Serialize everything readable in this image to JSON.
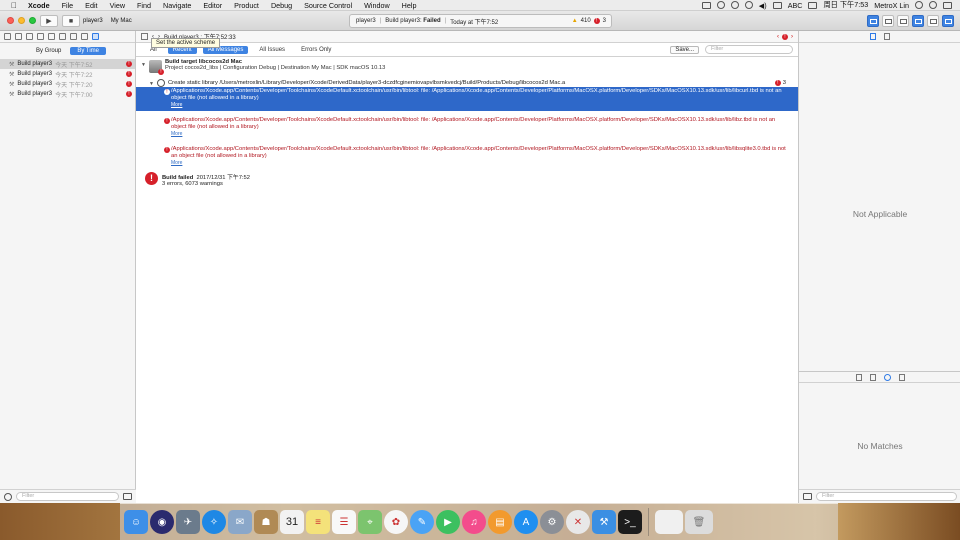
{
  "menubar": {
    "apple": "",
    "items": [
      "Xcode",
      "File",
      "Edit",
      "View",
      "Find",
      "Navigate",
      "Editor",
      "Product",
      "Debug",
      "Source Control",
      "Window",
      "Help"
    ],
    "input_source": "ABC",
    "clock": "周日 下午7:53",
    "user": "MetroX Lin"
  },
  "toolbar": {
    "run_glyph": "▶",
    "stop_glyph": "■",
    "scheme": "player3",
    "destination": "My Mac",
    "activity": {
      "project": "player3",
      "status_prefix": "Build player3:",
      "status_result": "Failed",
      "time": "Today at 下午7:52",
      "warnings": "410",
      "errors": "3"
    }
  },
  "tooltip": "Set the active scheme",
  "navigator": {
    "segments": [
      "By Group",
      "By Time"
    ],
    "items": [
      {
        "label": "Build player3",
        "time": "今天 下午7:52",
        "badge": "!"
      },
      {
        "label": "Build player3",
        "time": "今天 下午7:22",
        "badge": "!"
      },
      {
        "label": "Build player3",
        "time": "今天 下午7:20",
        "badge": "!"
      },
      {
        "label": "Build player3",
        "time": "今天 下午7:00",
        "badge": "!"
      }
    ],
    "filter_placeholder": "Filter"
  },
  "jumpbar": {
    "crumb": "Build player3 : 下午7:52:33"
  },
  "filterbar": {
    "scope": [
      "All",
      "Recent"
    ],
    "types": [
      "All Messages",
      "All Issues",
      "Errors Only"
    ],
    "save": "Save...",
    "filter_placeholder": "Filter"
  },
  "log": {
    "target_title": "Build target libcocos2d Mac",
    "target_detail": "Project cocos2d_libs | Configuration Debug | Destination My Mac | SDK macOS 10.13",
    "task": "Create static library /Users/metroxlin/Library/Developer/Xcode/DerivedData/player3-dczdfcginemiovapvlbsmkvedcj/Build/Products/Debug/libcocos2d Mac.a",
    "task_errors": "3",
    "messages": [
      {
        "text": "/Applications/Xcode.app/Contents/Developer/Toolchains/XcodeDefault.xctoolchain/usr/bin/libtool: file: /Applications/Xcode.app/Contents/Developer/Platforms/MacOSX.platform/Developer/SDKs/MacOSX10.13.sdk/usr/lib/libcurl.tbd is not an object file (not allowed in a library)",
        "more": "More"
      },
      {
        "text": "/Applications/Xcode.app/Contents/Developer/Toolchains/XcodeDefault.xctoolchain/usr/bin/libtool: file: /Applications/Xcode.app/Contents/Developer/Platforms/MacOSX.platform/Developer/SDKs/MacOSX10.13.sdk/usr/lib/libz.tbd is not an object file (not allowed in a library)",
        "more": "More"
      },
      {
        "text": "/Applications/Xcode.app/Contents/Developer/Toolchains/XcodeDefault.xctoolchain/usr/bin/libtool: file: /Applications/Xcode.app/Contents/Developer/Platforms/MacOSX.platform/Developer/SDKs/MacOSX10.13.sdk/usr/lib/libsqlite3.0.tbd is not an object file (not allowed in a library)",
        "more": "More"
      }
    ],
    "build_failed": "Build failed",
    "build_failed_time": "2017/12/31 下午7:52",
    "summary": "3 errors, 6073 warnings"
  },
  "inspector": {
    "not_applicable": "Not Applicable",
    "no_matches": "No Matches",
    "filter_placeholder": "Filter"
  },
  "dock": {
    "items": [
      {
        "name": "finder-icon",
        "color": "#3d8fe8",
        "glyph": "☺"
      },
      {
        "name": "siri-icon",
        "color": "#2a2a6e",
        "glyph": "◉"
      },
      {
        "name": "launchpad-icon",
        "color": "#6b7b8c",
        "glyph": "✈"
      },
      {
        "name": "safari-icon",
        "color": "#1e88e5",
        "glyph": "✧"
      },
      {
        "name": "mail-icon",
        "color": "#8aa7c9",
        "glyph": "✉"
      },
      {
        "name": "contacts-icon",
        "color": "#b08a55",
        "glyph": "☗"
      },
      {
        "name": "calendar-icon",
        "color": "#f2f2f2",
        "glyph": "31"
      },
      {
        "name": "notes-icon",
        "color": "#f4e27a",
        "glyph": "≡"
      },
      {
        "name": "reminders-icon",
        "color": "#f8f8f8",
        "glyph": "☰"
      },
      {
        "name": "maps-icon",
        "color": "#7cc46e",
        "glyph": "⌖"
      },
      {
        "name": "photos-icon",
        "color": "#f6f6f6",
        "glyph": "✿"
      },
      {
        "name": "messages-icon",
        "color": "#4aa3f5",
        "glyph": "✎"
      },
      {
        "name": "facetime-icon",
        "color": "#3cc060",
        "glyph": "▶"
      },
      {
        "name": "itunes-icon",
        "color": "#f34c8c",
        "glyph": "♫"
      },
      {
        "name": "ibooks-icon",
        "color": "#f29a2e",
        "glyph": "▤"
      },
      {
        "name": "appstore-icon",
        "color": "#1f8ff0",
        "glyph": "A"
      },
      {
        "name": "system-preferences-icon",
        "color": "#8b8f96",
        "glyph": "⚙"
      },
      {
        "name": "xcode-icon-dim",
        "color": "#e8e8e8",
        "glyph": "✕"
      },
      {
        "name": "xcode-icon",
        "color": "#3b8fe3",
        "glyph": "⚒"
      },
      {
        "name": "terminal-icon",
        "color": "#1c1c1c",
        "glyph": ">_"
      }
    ],
    "trash": {
      "name": "trash-icon",
      "color": "#dcdcdc",
      "glyph": "🗑"
    },
    "folder": {
      "name": "downloads-stack-icon",
      "color": "#f0f0f0",
      "glyph": ""
    }
  },
  "colors": {
    "accent": "#3e83e2",
    "error": "#d6202a",
    "selection": "#2e68c9"
  }
}
